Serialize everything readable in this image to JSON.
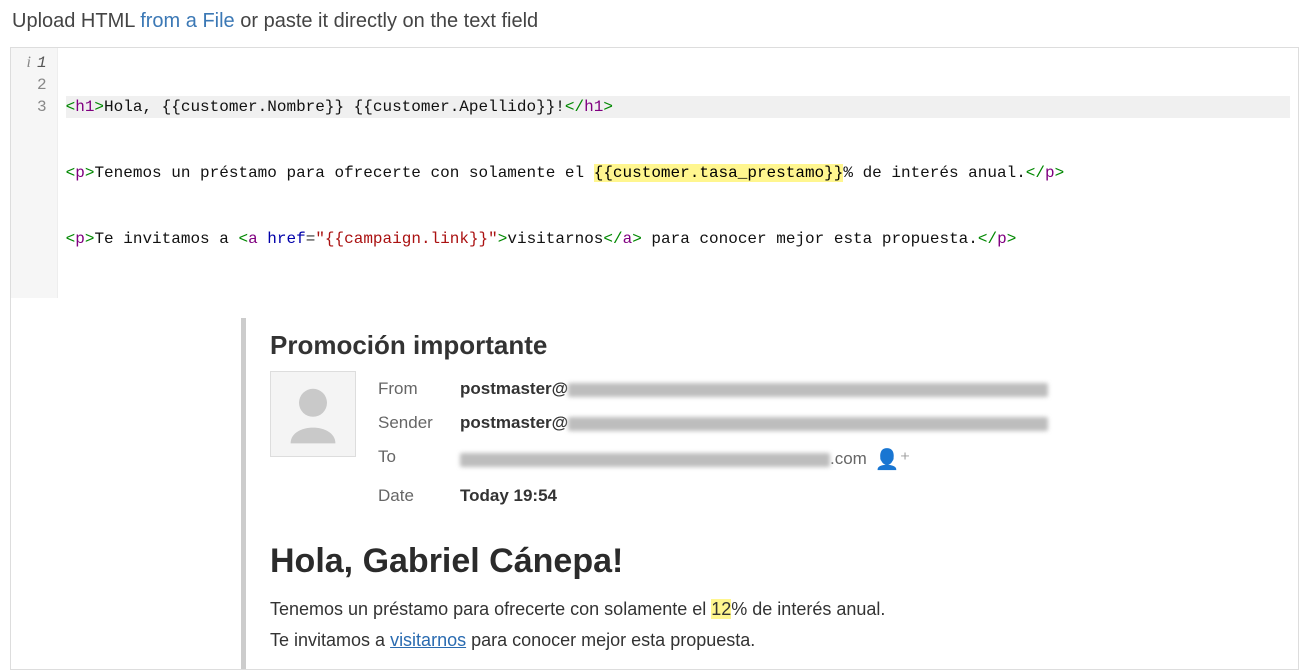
{
  "header": {
    "prefix": "Upload HTML ",
    "link": "from a File",
    "suffix": " or paste it directly on the text field"
  },
  "editor": {
    "gutter": [
      "1",
      "2",
      "3"
    ],
    "line1": {
      "t1_open": "<",
      "t1_name": "h1",
      "t1_close": ">",
      "txt1": "Hola, {{customer.Nombre}} {{customer.Apellido}}!",
      "t1c_open": "</",
      "t1c_name": "h1",
      "t1c_close": ">"
    },
    "line2": {
      "p_open": "<",
      "p_name": "p",
      "p_close": ">",
      "txt_a": "Tenemos un préstamo para ofrecerte con solamente el ",
      "tmpl": "{{customer.tasa_prestamo}}",
      "txt_b": "% de interés anual.",
      "pc_open": "</",
      "pc_name": "p",
      "pc_close": ">"
    },
    "line3": {
      "p_open": "<",
      "p_name": "p",
      "p_close": ">",
      "txt_a": "Te invitamos a ",
      "a_open": "<",
      "a_name": "a",
      "sp": " ",
      "attr": "href",
      "eq": "=",
      "q1": "\"",
      "href": "{{campaign.link}}",
      "q2": "\"",
      "a_close": ">",
      "linktxt": "visitarnos",
      "ac_open": "</",
      "ac_name": "a",
      "ac_close": ">",
      "txt_b": " para conocer mejor esta propuesta.",
      "pc_open": "</",
      "pc_name": "p",
      "pc_close": ">"
    }
  },
  "email": {
    "subject": "Promoción importante",
    "labels": {
      "from": "From",
      "sender": "Sender",
      "to": "To",
      "date": "Date"
    },
    "from_prefix": "postmaster@",
    "sender_prefix": "postmaster@",
    "to_suffix": ".com",
    "date": "Today 19:54",
    "body_h1": "Hola, Gabriel Cánepa!",
    "body_p1_a": "Tenemos un préstamo para ofrecerte con solamente el ",
    "body_p1_num": "12",
    "body_p1_b": "% de interés anual.",
    "body_p2_a": "Te invitamos a ",
    "body_p2_link": "visitarnos",
    "body_p2_b": " para conocer mejor esta propuesta."
  }
}
